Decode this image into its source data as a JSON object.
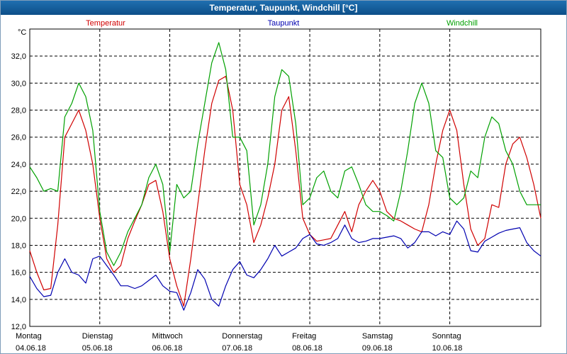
{
  "window_title": "Temperatur, Taupunkt, Windchill [°C]",
  "colors": {
    "temperatur": "#d00000",
    "taupunkt": "#0000b0",
    "windchill": "#00a000",
    "grid": "#000000"
  },
  "chart_data": {
    "type": "line",
    "title": "Temperatur, Taupunkt, Windchill [°C]",
    "y_unit": "°C",
    "ylim": [
      12,
      34
    ],
    "y_ticks": [
      "12,0",
      "14,0",
      "16,0",
      "18,0",
      "20,0",
      "22,0",
      "24,0",
      "26,0",
      "28,0",
      "30,0",
      "32,0"
    ],
    "xlim_days": [
      0,
      7.3
    ],
    "x_ticks": [
      {
        "day": "Montag",
        "date": "04.06.18"
      },
      {
        "day": "Dienstag",
        "date": "05.06.18"
      },
      {
        "day": "Mittwoch",
        "date": "06.06.18"
      },
      {
        "day": "Donnerstag",
        "date": "07.06.18"
      },
      {
        "day": "Freitag",
        "date": "08.06.18"
      },
      {
        "day": "Samstag",
        "date": "09.06.18"
      },
      {
        "day": "Sonntag",
        "date": "10.06.18"
      }
    ],
    "grid": true,
    "series": [
      {
        "name": "Temperatur",
        "color": "#d00000",
        "x": [
          0,
          0.1,
          0.2,
          0.3,
          0.4,
          0.5,
          0.6,
          0.7,
          0.8,
          0.9,
          1.0,
          1.1,
          1.2,
          1.3,
          1.4,
          1.5,
          1.6,
          1.7,
          1.8,
          1.9,
          2.0,
          2.1,
          2.2,
          2.3,
          2.4,
          2.5,
          2.6,
          2.7,
          2.8,
          2.9,
          3.0,
          3.1,
          3.2,
          3.3,
          3.4,
          3.5,
          3.6,
          3.7,
          3.8,
          3.9,
          4.0,
          4.1,
          4.2,
          4.3,
          4.4,
          4.5,
          4.6,
          4.7,
          4.8,
          4.9,
          5.0,
          5.1,
          5.2,
          5.3,
          5.4,
          5.5,
          5.6,
          5.7,
          5.8,
          5.9,
          6.0,
          6.1,
          6.2,
          6.3,
          6.4,
          6.5,
          6.6,
          6.7,
          6.8,
          6.9,
          7.0,
          7.1,
          7.2,
          7.3
        ],
        "y": [
          17.6,
          16.0,
          14.7,
          14.8,
          19.5,
          26.0,
          27.0,
          28.0,
          26.5,
          24.0,
          20.0,
          17.0,
          16.0,
          16.5,
          18.5,
          19.8,
          21.0,
          22.5,
          22.8,
          20.5,
          17.0,
          15.0,
          13.5,
          17.0,
          21.0,
          25.0,
          28.5,
          30.2,
          30.5,
          28.0,
          22.5,
          21.0,
          18.2,
          19.5,
          21.5,
          24.0,
          28.0,
          29.0,
          25.0,
          20.0,
          18.8,
          18.3,
          18.4,
          18.5,
          19.5,
          20.5,
          19.0,
          21.0,
          22.0,
          22.8,
          22.0,
          20.5,
          20.0,
          19.8,
          19.5,
          19.2,
          19.0,
          21.0,
          24.0,
          26.5,
          28.0,
          26.5,
          22.5,
          19.2,
          18.0,
          18.5,
          21.0,
          20.8,
          24.0,
          25.5,
          26.0,
          24.5,
          22.5,
          20.0
        ]
      },
      {
        "name": "Taupunkt",
        "color": "#0000b0",
        "x": [
          0,
          0.1,
          0.2,
          0.3,
          0.4,
          0.5,
          0.6,
          0.7,
          0.8,
          0.9,
          1.0,
          1.1,
          1.2,
          1.3,
          1.4,
          1.5,
          1.6,
          1.7,
          1.8,
          1.9,
          2.0,
          2.1,
          2.2,
          2.3,
          2.4,
          2.5,
          2.6,
          2.7,
          2.8,
          2.9,
          3.0,
          3.1,
          3.2,
          3.3,
          3.4,
          3.5,
          3.6,
          3.7,
          3.8,
          3.9,
          4.0,
          4.1,
          4.2,
          4.3,
          4.4,
          4.5,
          4.6,
          4.7,
          4.8,
          4.9,
          5.0,
          5.1,
          5.2,
          5.3,
          5.4,
          5.5,
          5.6,
          5.7,
          5.8,
          5.9,
          6.0,
          6.1,
          6.2,
          6.3,
          6.4,
          6.5,
          6.6,
          6.7,
          6.8,
          6.9,
          7.0,
          7.1,
          7.2,
          7.3
        ],
        "y": [
          15.7,
          14.8,
          14.2,
          14.3,
          16.0,
          17.0,
          16.0,
          15.8,
          15.2,
          17.0,
          17.2,
          16.5,
          15.8,
          15.0,
          15.0,
          14.8,
          15.0,
          15.4,
          15.8,
          15.0,
          14.6,
          14.5,
          13.2,
          14.5,
          16.2,
          15.5,
          14.0,
          13.5,
          15.0,
          16.2,
          16.8,
          15.8,
          15.6,
          16.2,
          17.0,
          18.0,
          17.2,
          17.5,
          17.8,
          18.5,
          18.8,
          18.1,
          18.0,
          18.2,
          18.5,
          19.5,
          18.5,
          18.2,
          18.3,
          18.5,
          18.5,
          18.6,
          18.7,
          18.5,
          17.8,
          18.2,
          19.0,
          19.0,
          18.7,
          19.0,
          18.8,
          19.8,
          19.2,
          17.6,
          17.5,
          18.3,
          18.6,
          18.9,
          19.1,
          19.2,
          19.3,
          18.2,
          17.6,
          17.2
        ]
      },
      {
        "name": "Windchill",
        "color": "#00a000",
        "x": [
          0,
          0.1,
          0.2,
          0.3,
          0.4,
          0.5,
          0.6,
          0.7,
          0.8,
          0.9,
          1.0,
          1.1,
          1.2,
          1.3,
          1.4,
          1.5,
          1.6,
          1.7,
          1.8,
          1.9,
          2.0,
          2.1,
          2.2,
          2.3,
          2.4,
          2.5,
          2.6,
          2.7,
          2.8,
          2.9,
          3.0,
          3.1,
          3.2,
          3.3,
          3.4,
          3.5,
          3.6,
          3.7,
          3.8,
          3.9,
          4.0,
          4.1,
          4.2,
          4.3,
          4.4,
          4.5,
          4.6,
          4.7,
          4.8,
          4.9,
          5.0,
          5.1,
          5.2,
          5.3,
          5.4,
          5.5,
          5.6,
          5.7,
          5.8,
          5.9,
          6.0,
          6.1,
          6.2,
          6.3,
          6.4,
          6.5,
          6.6,
          6.7,
          6.8,
          6.9,
          7.0,
          7.1,
          7.2,
          7.3
        ],
        "y": [
          23.8,
          23.0,
          22.0,
          22.2,
          22.0,
          27.5,
          28.5,
          30.0,
          29.0,
          26.5,
          20.5,
          17.5,
          16.5,
          17.5,
          19.0,
          20.0,
          21.0,
          23.0,
          24.0,
          22.5,
          17.5,
          22.5,
          21.5,
          22.0,
          25.5,
          28.5,
          31.5,
          33.0,
          31.0,
          26.0,
          26.0,
          25.0,
          19.5,
          21.0,
          24.0,
          29.0,
          31.0,
          30.5,
          27.0,
          21.0,
          21.5,
          23.0,
          23.5,
          22.0,
          21.5,
          23.5,
          23.8,
          22.5,
          21.0,
          20.5,
          20.5,
          20.2,
          19.8,
          22.0,
          25.0,
          28.5,
          30.0,
          28.5,
          25.0,
          24.5,
          21.5,
          21.0,
          21.5,
          23.5,
          23.0,
          26.0,
          27.5,
          27.0,
          25.0,
          24.0,
          22.0,
          21.0,
          21.0,
          21.0
        ]
      }
    ]
  }
}
